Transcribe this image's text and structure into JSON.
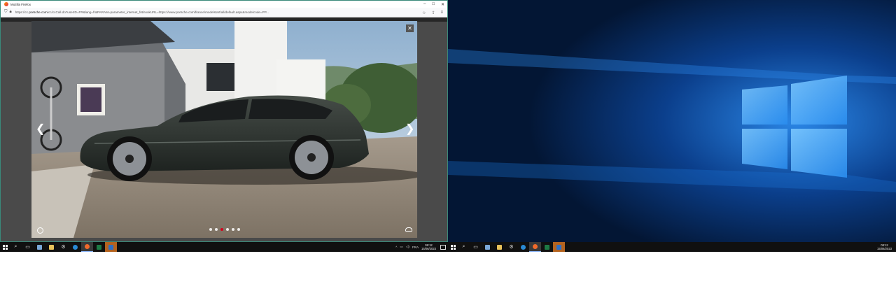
{
  "firefox": {
    "title": "Mozilla Firefox",
    "url_prefix": "https://cc.",
    "url_domain": "porsche.com",
    "url_rest": "/cc/ccCall.do?userID=FR&lang=fr&PARAM=parameter_internet_fr&hookURL=https://www.porsche.com/france/modelstart/all/default.aspx&modelcode=PP..."
  },
  "gallery": {
    "dot_count": 6,
    "active_dot": 2,
    "close_glyph": "✕",
    "prev_glyph": "❮",
    "next_glyph": "❯"
  },
  "taskbar_left": {
    "language": "FRA",
    "time": "08:12",
    "date": "15/06/2023"
  },
  "taskbar_right": {
    "time": "08:12",
    "date": "15/06/2023"
  },
  "colors": {
    "window_border": "#3a8a7a",
    "car_body": "#2f3531",
    "active_dot": "#d5001c",
    "wallpaper_glow": "#3fa9ff"
  },
  "icons": [
    "firefox-icon",
    "lock-icon",
    "shield-icon",
    "star-icon",
    "share-icon",
    "menu-icon",
    "close-icon",
    "chevron-left-icon",
    "chevron-right-icon",
    "steering-wheel-icon",
    "car-icon",
    "windows-logo-icon",
    "search-icon",
    "task-view-icon",
    "file-explorer-icon",
    "edge-icon",
    "excel-icon",
    "outlook-icon"
  ]
}
